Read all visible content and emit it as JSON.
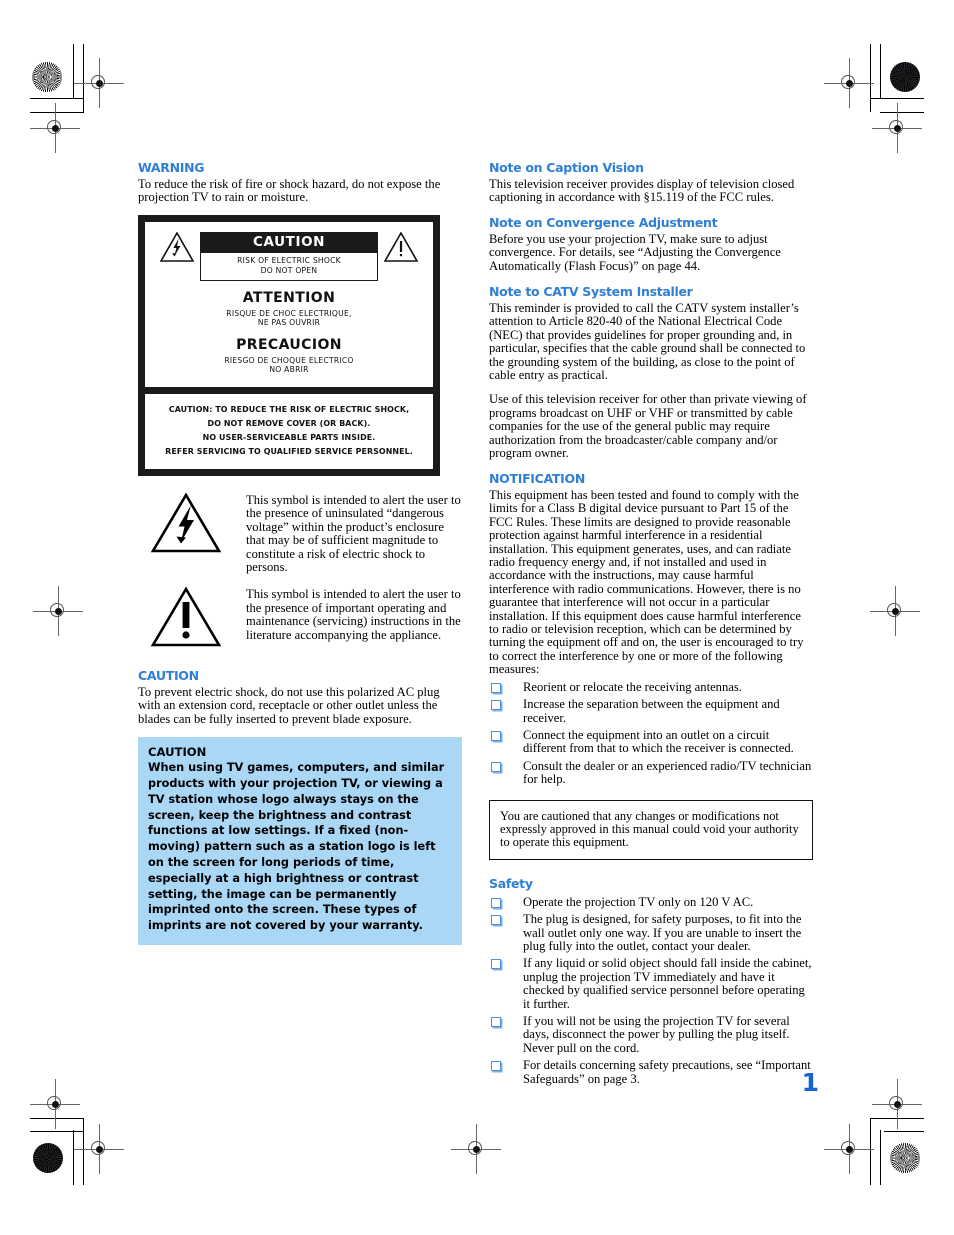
{
  "page": {
    "number": "1"
  },
  "colors": {
    "heading_blue": "#2F7FD6",
    "caution_box_blue": "#A9D7F5",
    "page_number_blue": "#1565D8",
    "panel_black": "#1b1b1b",
    "checkbox_blue": "#4f8fd8"
  },
  "left_column": {
    "warning": {
      "heading": "WARNING",
      "body": "To reduce the risk of fire or shock hazard, do not expose the projection TV to rain or moisture."
    },
    "caution_panel": {
      "caution_title": "CAUTION",
      "caution_sub_line1": "RISK OF ELECTRIC SHOCK",
      "caution_sub_line2": "DO NOT OPEN",
      "attention_title": "ATTENTION",
      "attention_sub_line1": "RISQUE DE CHOC ELECTRIQUE,",
      "attention_sub_line2": "NE PAS OUVRIR",
      "precaucion_title": "PRECAUCION",
      "precaucion_sub_line1": "RIESGO DE CHOQUE ELECTRICO",
      "precaucion_sub_line2": "NO ABRIR",
      "note_line1": "CAUTION:  TO REDUCE THE RISK OF ELECTRIC SHOCK,",
      "note_line2": "DO NOT REMOVE COVER (OR BACK).",
      "note_line3": "NO USER-SERVICEABLE PARTS INSIDE.",
      "note_line4": "REFER SERVICING TO QUALIFIED SERVICE PERSONNEL."
    },
    "symbol_legend": [
      {
        "icon": "lightning-bolt-triangle-icon",
        "text": "This symbol is intended to alert the user to the presence of uninsulated “dangerous voltage” within the product’s enclosure that may be of sufficient magnitude to constitute a risk of electric shock to persons."
      },
      {
        "icon": "exclamation-triangle-icon",
        "text": "This symbol is intended to alert the user to the presence of important operating and maintenance (servicing) instructions in the literature accompanying the appliance."
      }
    ],
    "caution": {
      "heading": "CAUTION",
      "body": "To prevent electric shock, do not use this polarized AC plug with an extension cord, receptacle or other outlet unless the blades can be fully inserted to prevent blade exposure."
    },
    "caution_blue_box": {
      "heading": "CAUTION",
      "body": "When using TV games, computers, and similar products with your projection TV, or viewing a TV station whose logo always stays on the screen, keep the brightness and contrast functions at low settings. If a fixed (non-moving) pattern such as a station logo is left on the screen for long periods of time, especially at a high brightness or contrast setting, the image can be permanently imprinted onto the screen. These types of imprints are not covered by your warranty."
    }
  },
  "right_column": {
    "caption_vision": {
      "heading": "Note on Caption Vision",
      "body": "This television receiver provides display of television closed captioning in accordance with §15.119 of the FCC rules."
    },
    "convergence": {
      "heading": "Note on Convergence Adjustment",
      "body": "Before you use your projection TV, make sure to adjust convergence. For details, see “Adjusting the Convergence Automatically (Flash Focus)” on page 44."
    },
    "catv": {
      "heading": "Note to CATV System Installer",
      "body1": "This reminder is provided to call the CATV system installer’s attention to Article 820-40 of the National Electrical Code (NEC) that provides guidelines for proper grounding and, in particular, specifies that the cable ground shall be connected to the grounding system of the building, as close to the point of cable entry as practical.",
      "body2": "Use of this television receiver for other than private viewing of programs broadcast on UHF or VHF or transmitted by cable companies for the use of the general public may require authorization from the broadcaster/cable company and/or program owner."
    },
    "notification": {
      "heading": "NOTIFICATION",
      "body": "This equipment has been tested and found to comply with the limits for a Class B digital device pursuant to Part 15 of the FCC Rules. These limits are designed to provide reasonable protection against harmful interference in a residential installation. This equipment generates, uses, and can radiate radio frequency energy and, if not installed and used in accordance with the instructions, may cause harmful interference with radio communications. However, there is no guarantee that interference will not occur in a particular installation. If this equipment does cause harmful interference to radio or television reception, which can be determined by turning the equipment off and on, the user is encouraged to try to correct the interference by one or more of the following measures:",
      "measures": [
        "Reorient or relocate the receiving antennas.",
        "Increase the separation between the equipment and receiver.",
        "Connect the equipment into an outlet on a circuit different from that to which the receiver is connected.",
        "Consult the dealer or an experienced radio/TV technician for help."
      ]
    },
    "notice_box": {
      "text": "You are cautioned that any changes or modifications not expressly approved in this manual could void your authority to operate this equipment."
    },
    "safety": {
      "heading": "Safety",
      "items": [
        "Operate the projection TV only on 120 V AC.",
        "The plug is designed, for safety purposes, to fit into the wall outlet only one way. If you are unable to insert the plug fully into the outlet, contact your dealer.",
        "If any liquid or solid object should fall inside the cabinet, unplug the projection TV immediately and have it checked by qualified service personnel before operating it further.",
        "If you will not be using the projection TV for several days, disconnect the power by pulling the plug itself. Never pull on the cord.",
        "For details concerning safety precautions, see “Important Safeguards” on page 3."
      ]
    }
  }
}
